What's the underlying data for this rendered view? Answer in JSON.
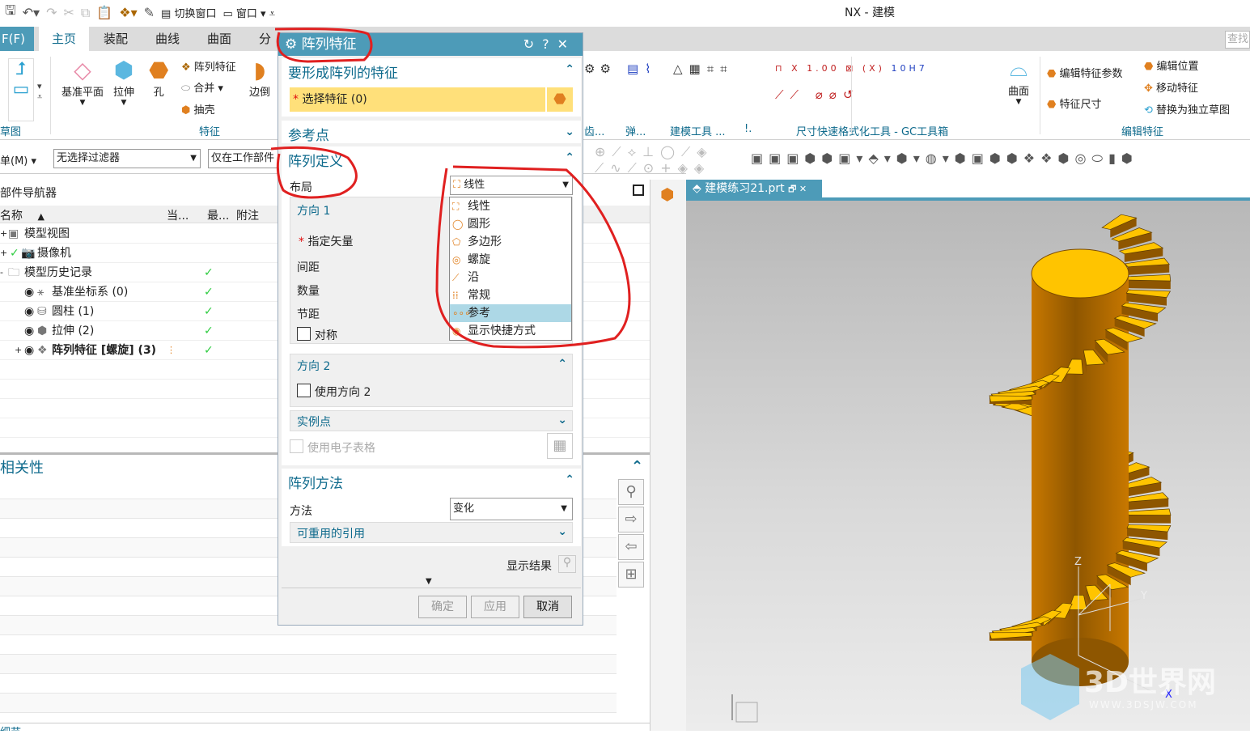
{
  "app": {
    "title": "NX - 建模"
  },
  "quick_access": {
    "switch_window": "切换窗口",
    "window": "窗口"
  },
  "ribbon": {
    "file_tab": "F(F)",
    "tabs": [
      "主页",
      "装配",
      "曲线",
      "曲面",
      "分"
    ],
    "find_placeholder": "查找",
    "home": {
      "datum_plane": "基准平面",
      "extrude": "拉伸",
      "hole": "孔",
      "pattern_feature": "阵列特征",
      "unite": "合并",
      "shell": "抽壳",
      "edge_blend": "边倒",
      "sketch_group": "草图",
      "feature_group": "特征"
    },
    "groups": [
      "齿...",
      "弹...",
      "建模工具 ...",
      "!.",
      "尺寸快速格式化工具 - GC工具箱",
      "编辑特征"
    ],
    "surface": "曲面",
    "edit": {
      "edit_feature_params": "编辑特征参数",
      "feature_dimension": "特征尺寸",
      "edit_position": "编辑位置",
      "move_feature": "移动特征",
      "replace_sketch": "替换为独立草图"
    },
    "gc_labels": [
      "1.00",
      "10H7"
    ]
  },
  "selection_bar": {
    "menu": "单(M)",
    "filter": "无选择过滤器",
    "scope": "仅在工作部件"
  },
  "navigator": {
    "title": "部件导航器",
    "columns": [
      "名称",
      "当...",
      "最...",
      "附注"
    ],
    "rows": [
      {
        "name": "模型视图",
        "check": false
      },
      {
        "name": "摄像机",
        "check": false
      },
      {
        "name": "模型历史记录",
        "check": true
      },
      {
        "name": "基准坐标系 (0)",
        "check": true
      },
      {
        "name": "圆柱 (1)",
        "check": true
      },
      {
        "name": "拉伸 (2)",
        "check": true
      },
      {
        "name": "阵列特征 [螺旋] (3)",
        "check": true
      }
    ],
    "check_glyph": "✓"
  },
  "relations": {
    "title": "相关性",
    "bottom": "细节"
  },
  "viewport": {
    "tab": "建模练习21.prt",
    "axes": [
      "Z",
      "Y",
      "X"
    ],
    "watermark": "3D世界网",
    "watermark_url": "WWW.3DSJW.COM"
  },
  "dialog": {
    "title": "阵列特征",
    "features_section": "要形成阵列的特征",
    "select_feature": "选择特征 (0)",
    "ref_point": "参考点",
    "pattern_def": "阵列定义",
    "layout_label": "布局",
    "layout_value": "线性",
    "layout_options": [
      "线性",
      "圆形",
      "多边形",
      "螺旋",
      "沿",
      "常规",
      "参考",
      "显示快捷方式"
    ],
    "layout_selected": "参考",
    "direction1": "方向 1",
    "specify_vector": "指定矢量",
    "spacing": "间距",
    "count": "数量",
    "pitch": "节距",
    "symmetric": "对称",
    "direction2": "方向 2",
    "use_direction2": "使用方向 2",
    "instance_points": "实例点",
    "use_spreadsheet": "使用电子表格",
    "pattern_method": "阵列方法",
    "method_label": "方法",
    "method_value": "变化",
    "reusable_refs": "可重用的引用",
    "show_result": "显示结果",
    "ok": "确定",
    "apply": "应用",
    "cancel": "取消"
  },
  "colors": {
    "accent": "#4d9bb8",
    "highlight": "#ffe07a",
    "annotation": "#e02020",
    "model": "#c87800",
    "steps": "#ffc400"
  }
}
